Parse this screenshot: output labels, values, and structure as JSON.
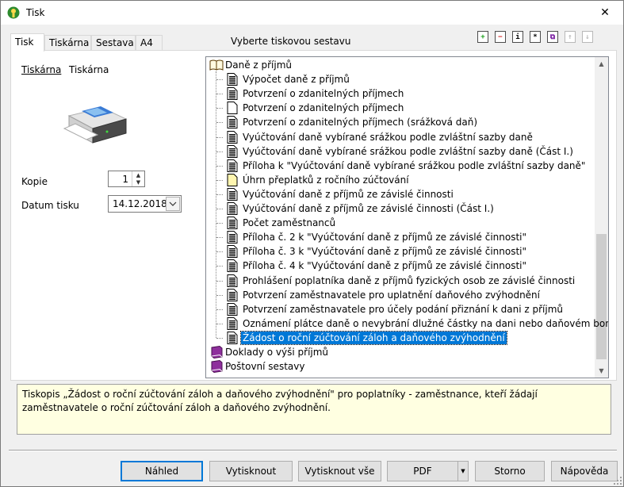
{
  "window": {
    "title": "Tisk",
    "close_glyph": "✕"
  },
  "tabs": [
    {
      "label": "Tisk",
      "active": true
    },
    {
      "label": "Tiskárna",
      "active": false
    },
    {
      "label": "Sestava",
      "active": false
    },
    {
      "label": "A4",
      "active": false
    }
  ],
  "report_heading": "Vyberte tiskovou sestavu",
  "toolbar": [
    {
      "name": "add-icon",
      "glyph": "+",
      "color": "#1a9e1a",
      "enabled": true
    },
    {
      "name": "remove-icon",
      "glyph": "−",
      "color": "#d42020",
      "enabled": true
    },
    {
      "name": "info-icon",
      "glyph": "i",
      "color": "#000000",
      "enabled": true
    },
    {
      "name": "asterisk-icon",
      "glyph": "*",
      "color": "#000000",
      "enabled": true
    },
    {
      "name": "copy-icon",
      "glyph": "⧉",
      "color": "#7a1fa2",
      "enabled": true
    },
    {
      "name": "move-up-icon",
      "glyph": "↑",
      "color": "#b8b8b8",
      "enabled": false
    },
    {
      "name": "move-down-icon",
      "glyph": "↓",
      "color": "#b8b8b8",
      "enabled": false
    }
  ],
  "printer": {
    "link_label": "Tiskárna",
    "name": "Tiskárna"
  },
  "copies": {
    "label": "Kopie",
    "value": "1"
  },
  "print_date": {
    "label": "Datum tisku",
    "value": "14.12.2018"
  },
  "tree": {
    "groups": [
      {
        "label": "Daně z příjmů",
        "expanded": true,
        "icon": "open-book-icon",
        "items": [
          {
            "label": "Výpočet daně z příjmů",
            "icon": "document-filled"
          },
          {
            "label": "Potvrzení o zdanitelných příjmech",
            "icon": "document-filled"
          },
          {
            "label": "Potvrzení o zdanitelných příjmech",
            "icon": "document-blank"
          },
          {
            "label": "Potvrzení o zdanitelných příjmech (srážková daň)",
            "icon": "document-filled"
          },
          {
            "label": "Vyúčtování daně vybírané srážkou podle zvláštní sazby daně",
            "icon": "document-filled"
          },
          {
            "label": "Vyúčtování daně vybírané srážkou podle zvláštní sazby daně (Část I.)",
            "icon": "document-filled"
          },
          {
            "label": "Příloha k \"Vyúčtování daně vybírané srážkou podle zvláštní sazby daně\"",
            "icon": "document-filled"
          },
          {
            "label": "Úhrn přeplatků z ročního zúčtování",
            "icon": "document-yellow"
          },
          {
            "label": "Vyúčtování daně z příjmů ze závislé činnosti",
            "icon": "document-filled"
          },
          {
            "label": "Vyúčtování daně z příjmů ze závislé činnosti (Část I.)",
            "icon": "document-filled"
          },
          {
            "label": "Počet zaměstnanců",
            "icon": "document-filled"
          },
          {
            "label": "Příloha č. 2 k \"Vyúčtování daně z příjmů ze závislé činnosti\"",
            "icon": "document-filled"
          },
          {
            "label": "Příloha č. 3 k \"Vyúčtování daně z příjmů ze závislé činnosti\"",
            "icon": "document-filled"
          },
          {
            "label": "Příloha č. 4 k \"Vyúčtování daně z příjmů ze závislé činnosti\"",
            "icon": "document-filled"
          },
          {
            "label": "Prohlášení poplatníka daně z příjmů fyzických osob ze závislé činnosti",
            "icon": "document-filled"
          },
          {
            "label": "Potvrzení zaměstnavatele pro uplatnění daňového zvýhodnění",
            "icon": "document-filled"
          },
          {
            "label": "Potvrzení zaměstnavatele pro účely podání přiznání k dani z příjmů",
            "icon": "document-filled"
          },
          {
            "label": "Oznámení plátce daně o nevybrání dlužné částky na dani nebo daňovém bonusu",
            "icon": "document-filled"
          },
          {
            "label": "Žádost o roční zúčtování záloh a daňového zvýhodnění",
            "icon": "document-filled",
            "selected": true
          }
        ]
      },
      {
        "label": "Doklady o výši příjmů",
        "expanded": false,
        "icon": "closed-book-icon",
        "items": []
      },
      {
        "label": "Poštovní sestavy",
        "expanded": false,
        "icon": "closed-book-icon",
        "items": []
      }
    ]
  },
  "description": "Tiskopis „Žádost o roční zúčtování záloh a daňového zvýhodnění\" pro poplatníky - zaměstnance, kteří žádají zaměstnavatele o roční zúčtování záloh a daňového zvýhodnění.",
  "buttons": {
    "preview": "Náhled",
    "print": "Vytisknout",
    "print_all": "Vytisknout vše",
    "pdf": "PDF",
    "cancel": "Storno",
    "help": "Nápověda"
  },
  "colors": {
    "selection": "#0078d7",
    "description_bg": "#ffffe1"
  }
}
